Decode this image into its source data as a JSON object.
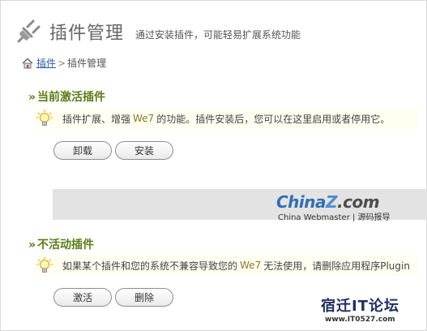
{
  "header": {
    "title": "插件管理",
    "subtitle": "通过安装插件，可能轻易扩展系统功能"
  },
  "breadcrumb": {
    "link": "插件",
    "separator": ">",
    "current": "插件管理"
  },
  "active_section": {
    "prefix": "»",
    "title": "当前激活插件",
    "tip_before": "插件扩展、增强",
    "tip_highlight": "We7",
    "tip_after": "的功能。插件安装后，您可以在这里启用或者停用它。",
    "buttons": {
      "uninstall": "卸载",
      "install": "安装"
    }
  },
  "inactive_section": {
    "prefix": "»",
    "title": "不活动插件",
    "tip_before": "如果某个插件和您的系统不兼容导致您的",
    "tip_highlight": "We7",
    "tip_after": "无法使用，请删除应用程序Plugin",
    "buttons": {
      "activate": "激活",
      "delete": "删除"
    }
  },
  "banner": {
    "brand_main": "China",
    "brand_z": "Z",
    "brand_dotcom": ".com",
    "brand_sub": "China Webmaster | 源码报导"
  },
  "watermark": {
    "name": "宿迁IT论坛",
    "url": "www.IT0527.com"
  },
  "icons": {
    "header": "plug-icon",
    "breadcrumb": "home-icon",
    "tip": "lightbulb-icon"
  },
  "colors": {
    "section_title": "#5a7d16",
    "link": "#2a5d9f",
    "tip_bg": "#fffef0",
    "brand_blue": "#2f6fb2"
  }
}
